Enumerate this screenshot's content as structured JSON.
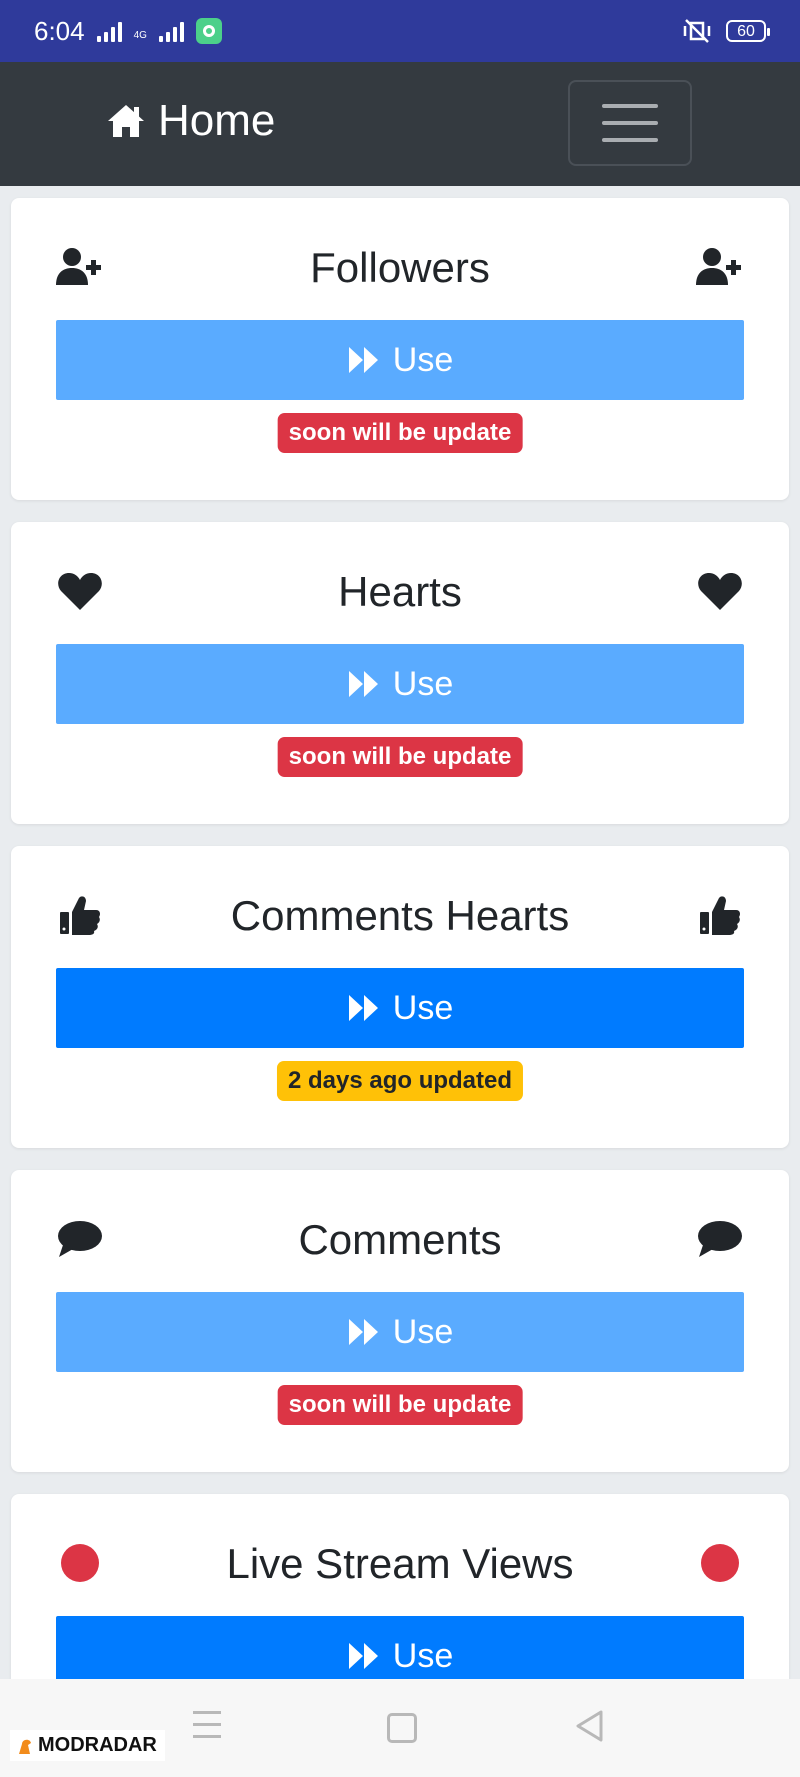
{
  "status_bar": {
    "time": "6:04",
    "network": "4G",
    "battery": "60"
  },
  "navbar": {
    "brand": "Home",
    "brand_icon": "home-icon",
    "toggle_icon": "hamburger-icon"
  },
  "cards": [
    {
      "title": "Followers",
      "icon": "user-plus-icon",
      "button": "Use",
      "button_state": "light",
      "badge": "soon will be update",
      "badge_type": "danger"
    },
    {
      "title": "Hearts",
      "icon": "heart-icon",
      "button": "Use",
      "button_state": "light",
      "badge": "soon will be update",
      "badge_type": "danger"
    },
    {
      "title": "Comments Hearts",
      "icon": "thumbs-up-icon",
      "button": "Use",
      "button_state": "solid",
      "badge": "2 days ago updated",
      "badge_type": "warning"
    },
    {
      "title": "Comments",
      "icon": "comment-icon",
      "button": "Use",
      "button_state": "light",
      "badge": "soon will be update",
      "badge_type": "danger"
    },
    {
      "title": "Live Stream Views",
      "icon": "live-dot-icon",
      "button": "Use",
      "button_state": "solid",
      "badge": "",
      "badge_type": ""
    }
  ],
  "watermark": "MODRADAR",
  "colors": {
    "status_bar": "#2f3a9b",
    "navbar": "#343a40",
    "primary": "#007bff",
    "primary_light": "#5aabff",
    "danger": "#dc3545",
    "warning": "#ffc107",
    "live": "#dc3545"
  }
}
